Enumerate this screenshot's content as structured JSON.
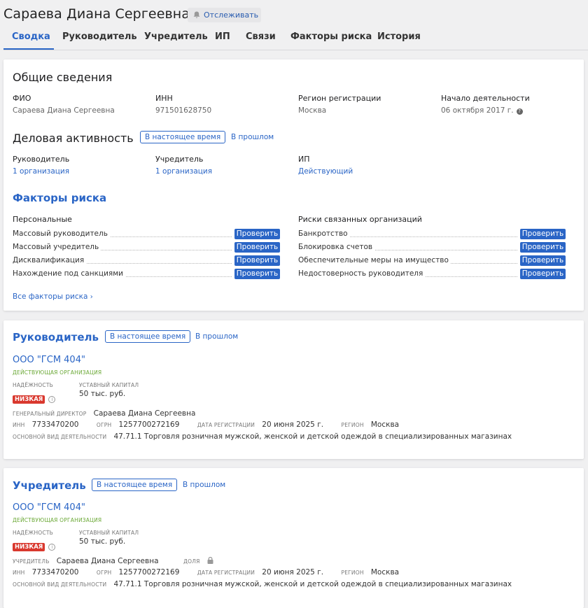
{
  "header": {
    "title": "Сараева Диана Сергеевна",
    "follow_label": "Отслеживать",
    "follow_icon": "bell-icon"
  },
  "tabs": [
    {
      "label": "Сводка",
      "active": true
    },
    {
      "label": "Руководитель",
      "active": false
    },
    {
      "label": "Учредитель",
      "active": false
    },
    {
      "label": "ИП",
      "active": false
    },
    {
      "label": "Связи",
      "active": false
    },
    {
      "label": "Факторы риска",
      "active": false
    },
    {
      "label": "История",
      "active": false
    }
  ],
  "general": {
    "title": "Общие сведения",
    "fio_label": "ФИО",
    "fio_value": "Сараева Диана Сергеевна",
    "inn_label": "ИНН",
    "inn_value": "971501628750",
    "region_label": "Регион регистрации",
    "region_value": "Москва",
    "start_label": "Начало деятельности",
    "start_value": "06 октября 2017 г.",
    "help_glyph": "?"
  },
  "activity": {
    "title": "Деловая активность",
    "toggle_now": "В настоящее время",
    "toggle_past": "В прошлом",
    "manager_label": "Руководитель",
    "manager_value": "1 организация",
    "founder_label": "Учредитель",
    "founder_value": "1 организация",
    "ip_label": "ИП",
    "ip_value": "Действующий"
  },
  "risks": {
    "title": "Факторы риска",
    "personal_title": "Персональные",
    "related_title": "Риски связанных организаций",
    "check_label": "Проверить",
    "personal": [
      "Массовый руководитель",
      "Массовый учредитель",
      "Дисквалификация",
      "Нахождение под санкциями"
    ],
    "related": [
      "Банкротство",
      "Блокировка счетов",
      "Обеспечительные меры на имущество",
      "Недостоверность руководителя"
    ],
    "all_link": "Все факторы риска",
    "chevron": "›"
  },
  "manager_card": {
    "title": "Руководитель",
    "toggle_now": "В настоящее время",
    "toggle_past": "В прошлом",
    "org_name": "ООО \"ГСМ 404\"",
    "org_status": "ДЕЙСТВУЮЩАЯ ОРГАНИЗАЦИЯ",
    "reliability_label": "НАДЁЖНОСТЬ",
    "reliability_value": "НИЗКАЯ",
    "capital_label": "УСТАВНЫЙ КАПИТАЛ",
    "capital_value": "50 тыс. руб.",
    "role_label": "ГЕНЕРАЛЬНЫЙ ДИРЕКТОР",
    "role_value": "Сараева Диана Сергеевна",
    "inn_label": "ИНН",
    "inn_value": "7733470200",
    "ogrn_label": "ОГРН",
    "ogrn_value": "1257700272169",
    "reg_label": "ДАТА РЕГИСТРАЦИИ",
    "reg_value": "20 июня 2025 г.",
    "region_label": "РЕГИОН",
    "region_value": "Москва",
    "okved_label": "ОСНОВНОЙ ВИД ДЕЯТЕЛЬНОСТИ",
    "okved_value": "47.71.1 Торговля розничная мужской, женской и детской одеждой в специализированных магазинах",
    "info_glyph": "i"
  },
  "founder_card": {
    "title": "Учредитель",
    "toggle_now": "В настоящее время",
    "toggle_past": "В прошлом",
    "org_name": "ООО \"ГСМ 404\"",
    "org_status": "ДЕЙСТВУЮЩАЯ ОРГАНИЗАЦИЯ",
    "reliability_label": "НАДЁЖНОСТЬ",
    "reliability_value": "НИЗКАЯ",
    "capital_label": "УСТАВНЫЙ КАПИТАЛ",
    "capital_value": "50 тыс. руб.",
    "role_label": "УЧРЕДИТЕЛЬ",
    "role_value": "Сараева Диана Сергеевна",
    "share_label": "ДОЛЯ",
    "inn_label": "ИНН",
    "inn_value": "7733470200",
    "ogrn_label": "ОГРН",
    "ogrn_value": "1257700272169",
    "reg_label": "ДАТА РЕГИСТРАЦИИ",
    "reg_value": "20 июня 2025 г.",
    "region_label": "РЕГИОН",
    "region_value": "Москва",
    "okved_label": "ОСНОВНОЙ ВИД ДЕЯТЕЛЬНОСТИ",
    "okved_value": "47.71.1 Торговля розничная мужской, женской и детской одеждой в специализированных магазинах",
    "info_glyph": "i"
  },
  "colors": {
    "accent": "#2a65c6",
    "danger": "#d9382e",
    "success": "#6aa835"
  }
}
